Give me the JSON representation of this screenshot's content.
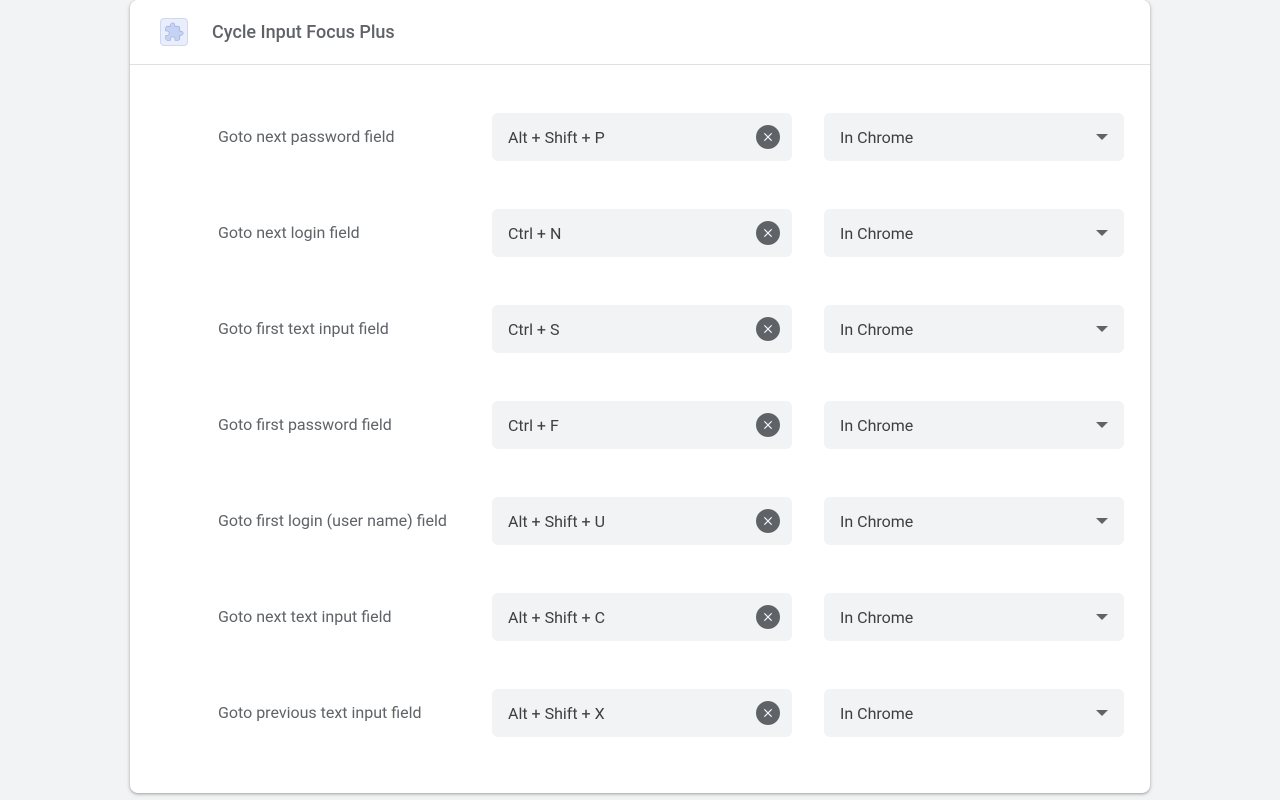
{
  "extension": {
    "title": "Cycle Input Focus Plus"
  },
  "shortcuts": [
    {
      "label": "Goto next password field",
      "key": "Alt + Shift + P",
      "scope": "In Chrome"
    },
    {
      "label": "Goto next login field",
      "key": "Ctrl + N",
      "scope": "In Chrome"
    },
    {
      "label": "Goto first text input field",
      "key": "Ctrl + S",
      "scope": "In Chrome"
    },
    {
      "label": "Goto first password field",
      "key": "Ctrl + F",
      "scope": "In Chrome"
    },
    {
      "label": "Goto first login (user name) field",
      "key": "Alt + Shift + U",
      "scope": "In Chrome"
    },
    {
      "label": "Goto next text input field",
      "key": "Alt + Shift + C",
      "scope": "In Chrome"
    },
    {
      "label": "Goto previous text input field",
      "key": "Alt + Shift + X",
      "scope": "In Chrome"
    }
  ]
}
